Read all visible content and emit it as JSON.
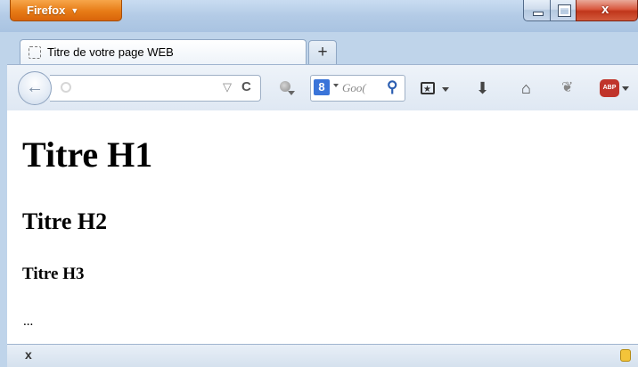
{
  "window": {
    "menu_button_label": "Firefox",
    "controls": {
      "minimize": "minimize",
      "maximize": "maximize",
      "close": "x"
    }
  },
  "tabs": [
    {
      "label": "Titre de votre page WEB",
      "active": true
    }
  ],
  "new_tab_label": "+",
  "toolbar": {
    "url_value": "",
    "search_engine": "8",
    "search_placeholder": "Goo(",
    "icons": [
      "back-arrow-icon",
      "globe-icon",
      "dropmarker-star-icon",
      "reload-icon",
      "search-engine-icon",
      "google-icon",
      "magnifier-icon",
      "bookmarks-icon",
      "downloads-icon",
      "home-icon",
      "sync-icon",
      "adblock-plus-icon"
    ],
    "abp_label": "ABP"
  },
  "content": {
    "h1": "Titre H1",
    "h2": "Titre H2",
    "h3": "Titre H3",
    "paragraph": "..."
  },
  "statusbar": {
    "close_label": "x"
  },
  "colors": {
    "firefox_button": "#e77b16",
    "close_button": "#c0361b",
    "frame": "#bfd4ea"
  }
}
